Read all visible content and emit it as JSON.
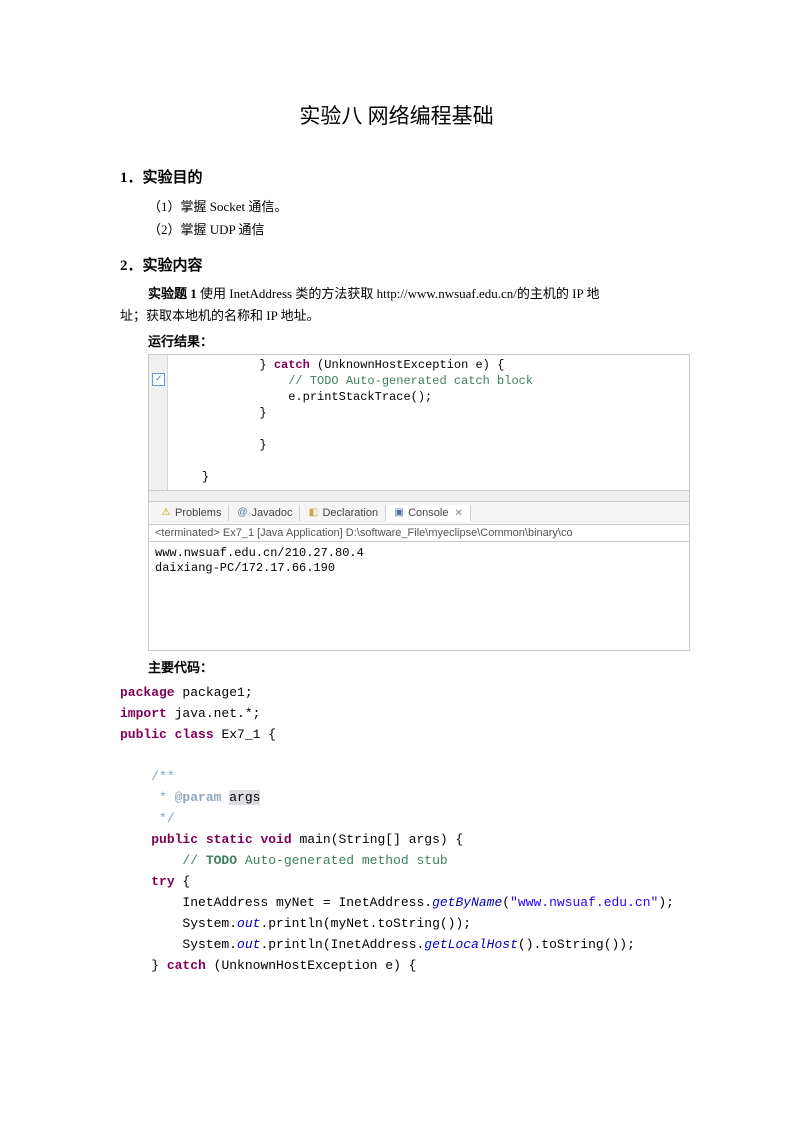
{
  "title": "实验八 网络编程基础",
  "section1": {
    "heading": "1．实验目的",
    "p1": "（1）掌握 Socket 通信。",
    "p2": "（2）掌握 UDP 通信"
  },
  "section2": {
    "heading": "2．实验内容",
    "taskLabel": "实验题 1",
    "taskText1": " 使用 InetAddress 类的方法获取 http://www.nwsuaf.edu.cn/的主机的 IP 地",
    "taskText2": "址；获取本地机的名称和 IP 地址。",
    "runLabel": "运行结果：",
    "codeLabel": "主要代码："
  },
  "ide": {
    "editor": {
      "l1a": "} ",
      "l1kw": "catch",
      "l1b": " (UnknownHostException e) {",
      "l2": "// TODO Auto-generated catch block",
      "l3": "e.printStackTrace();",
      "l4": "}",
      "l5": "",
      "l6": "}",
      "l7": "",
      "l8": "}"
    },
    "tabs": {
      "problems": "Problems",
      "javadoc": "Javadoc",
      "declaration": "Declaration",
      "console": "Console"
    },
    "terminatedLine": "<terminated> Ex7_1 [Java Application] D:\\software_File\\myeclipse\\Common\\binary\\co",
    "consoleOut": {
      "l1": "www.nwsuaf.edu.cn/210.27.80.4",
      "l2": "daixiang-PC/172.17.66.190"
    }
  },
  "code": {
    "l01a": "package",
    "l01b": " package1;",
    "l02a": "import",
    "l02b": " java.net.*;",
    "l03a": "public",
    "l03b": "class",
    "l03c": " Ex7_1 {",
    "l05": "/**",
    "l06a": " * ",
    "l06b": "@param",
    "l06c": " ",
    "l06d": "args",
    "l07": " */",
    "l08a": "public",
    "l08b": "static",
    "l08c": "void",
    "l08d": " main(String[] args) {",
    "l09a": "// ",
    "l09b": "TODO",
    "l09c": " Auto-generated method stub",
    "l10a": "try",
    "l10b": " {",
    "l11a": "InetAddress myNet = InetAddress.",
    "l11b": "getByName",
    "l11c": "(",
    "l11d": "\"www.nwsuaf.edu.cn\"",
    "l11e": ");",
    "l12a": "System.",
    "l12b": "out",
    "l12c": ".println(myNet.toString());",
    "l13a": "System.",
    "l13b": "out",
    "l13c": ".println(InetAddress.",
    "l13d": "getLocalHost",
    "l13e": "().toString());",
    "l14a": "} ",
    "l14b": "catch",
    "l14c": " (UnknownHostException e) {"
  }
}
